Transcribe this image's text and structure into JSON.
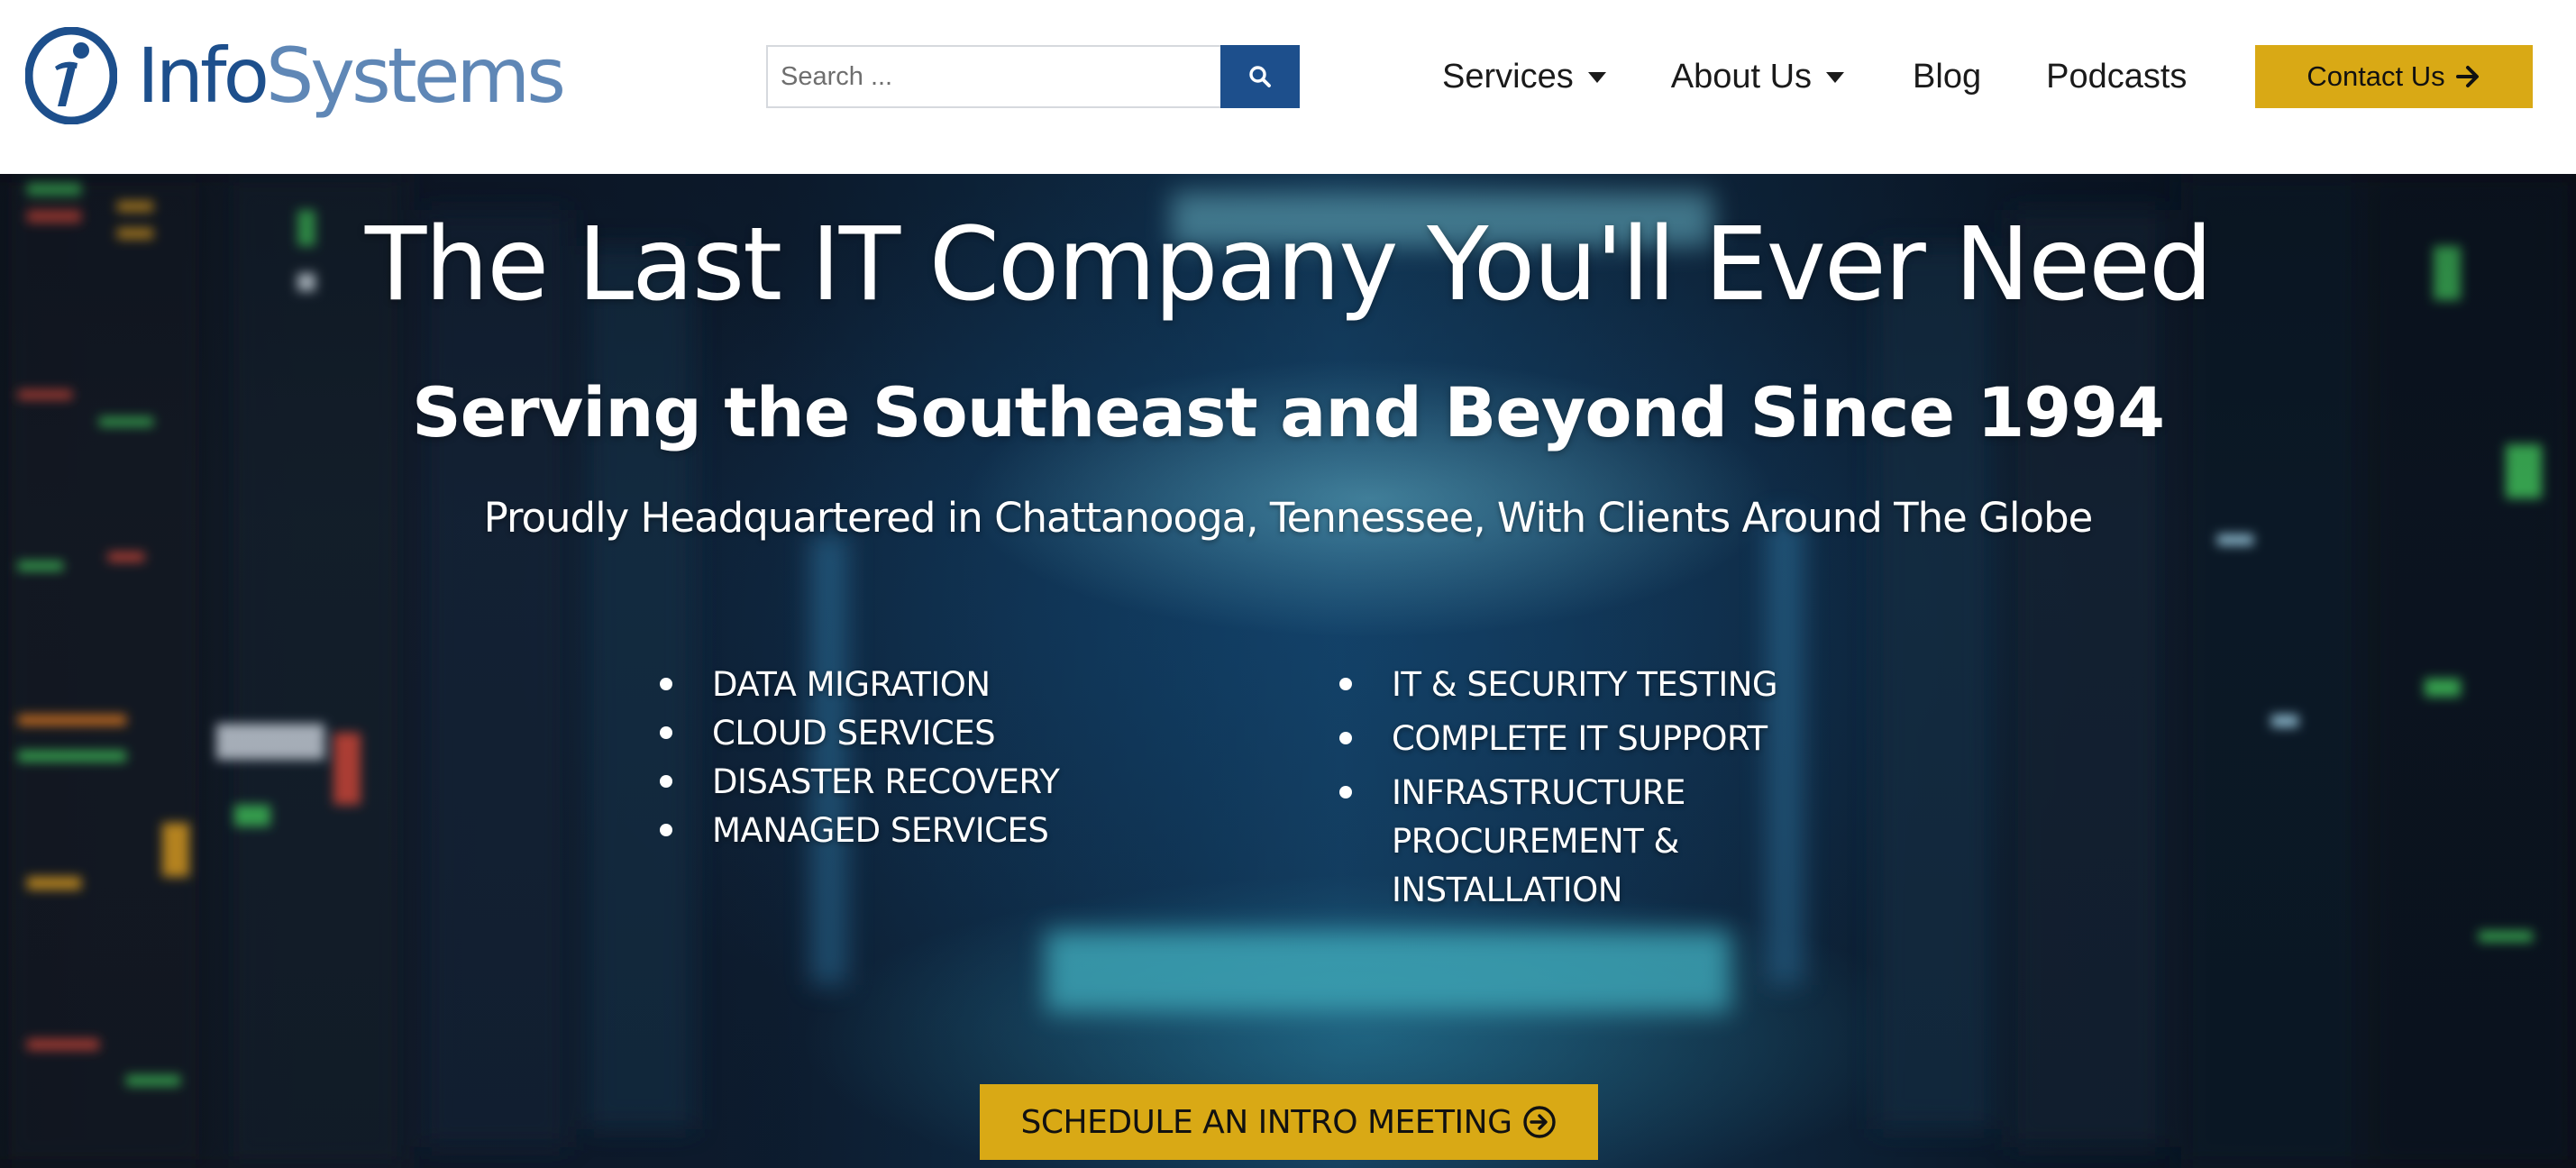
{
  "brand": {
    "logo_prefix": "Info",
    "logo_suffix": "Systems",
    "logo_mark_icon": "infosystems-i-logo-icon",
    "primary_color": "#1d4f8c",
    "secondary_color": "#5f87b6",
    "accent_color": "#d9a915"
  },
  "search": {
    "placeholder": "Search ...",
    "value": "",
    "button_icon": "search-icon"
  },
  "nav": {
    "items": [
      {
        "label": "Services",
        "has_dropdown": true
      },
      {
        "label": "About Us",
        "has_dropdown": true
      },
      {
        "label": "Blog",
        "has_dropdown": false
      },
      {
        "label": "Podcasts",
        "has_dropdown": false
      }
    ],
    "contact_label": "Contact Us",
    "contact_icon": "arrow-right-icon"
  },
  "hero": {
    "title": "The Last IT Company You'll Ever Need",
    "subtitle": "Serving the Southeast and Beyond Since 1994",
    "tagline": "Proudly Headquartered in Chattanooga, Tennessee, With Clients Around The Globe",
    "services_left": [
      "DATA MIGRATION",
      "CLOUD SERVICES",
      "DISASTER RECOVERY",
      "MANAGED SERVICES"
    ],
    "services_right": [
      "IT & SECURITY TESTING",
      "COMPLETE IT SUPPORT",
      "INFRASTRUCTURE PROCUREMENT & INSTALLATION"
    ],
    "cta_label": "SCHEDULE AN INTRO MEETING",
    "cta_icon": "arrow-circle-right-icon",
    "background_image": "server-room-background"
  }
}
